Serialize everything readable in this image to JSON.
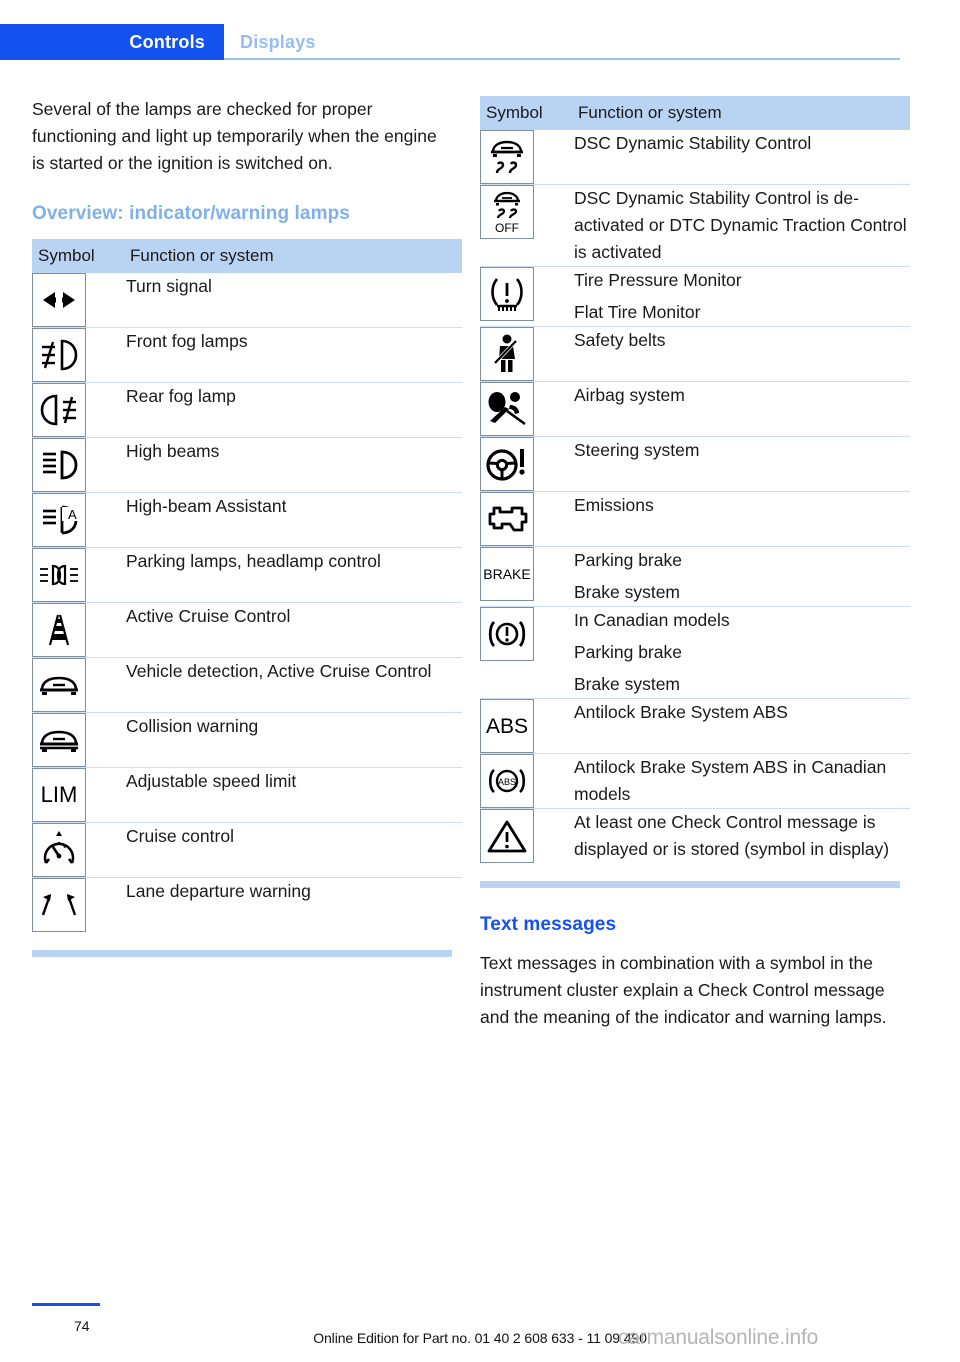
{
  "header": {
    "active_tab": "Controls",
    "inactive_tab": "Displays"
  },
  "left_column": {
    "intro_paragraph": "Several of the lamps are checked for proper functioning and light up temporarily when the engine is started or the ignition is switched on.",
    "section_title": "Overview: indicator/warning lamps",
    "table": {
      "headers": [
        "Symbol",
        "Function or system"
      ],
      "rows": [
        {
          "icon": "turn-signal-icon",
          "lines": [
            "Turn signal"
          ]
        },
        {
          "icon": "front-fog-lamps-icon",
          "lines": [
            "Front fog lamps"
          ]
        },
        {
          "icon": "rear-fog-lamp-icon",
          "lines": [
            "Rear fog lamp"
          ]
        },
        {
          "icon": "high-beams-icon",
          "lines": [
            "High beams"
          ]
        },
        {
          "icon": "high-beam-assistant-icon",
          "lines": [
            "High-beam Assistant"
          ]
        },
        {
          "icon": "parking-lamps-headlamp-control-icon",
          "lines": [
            "Parking lamps, headlamp control"
          ]
        },
        {
          "icon": "active-cruise-control-icon",
          "lines": [
            "Active Cruise Control"
          ]
        },
        {
          "icon": "vehicle-detection-icon",
          "lines": [
            "Vehicle detection, Active Cruise Control"
          ]
        },
        {
          "icon": "collision-warning-icon",
          "lines": [
            "Collision warning"
          ]
        },
        {
          "icon": "adjustable-speed-limit-icon",
          "lines": [
            "Adjustable speed limit"
          ]
        },
        {
          "icon": "cruise-control-icon",
          "lines": [
            "Cruise control"
          ]
        },
        {
          "icon": "lane-departure-warning-icon",
          "lines": [
            "Lane departure warning"
          ]
        }
      ]
    }
  },
  "right_column": {
    "table": {
      "headers": [
        "Symbol",
        "Function or system"
      ],
      "rows": [
        {
          "icon": "dsc-icon",
          "lines": [
            "DSC Dynamic Stability Control"
          ]
        },
        {
          "icon": "dsc-off-icon",
          "lines": [
            "DSC Dynamic Stability Control is de-activated or DTC Dynamic Traction Control is activated"
          ]
        },
        {
          "icon": "tire-pressure-monitor-icon",
          "lines": [
            "Tire Pressure Monitor",
            "Flat Tire Monitor"
          ]
        },
        {
          "icon": "safety-belts-icon",
          "lines": [
            "Safety belts"
          ]
        },
        {
          "icon": "airbag-system-icon",
          "lines": [
            "Airbag system"
          ]
        },
        {
          "icon": "steering-system-icon",
          "lines": [
            "Steering system"
          ]
        },
        {
          "icon": "emissions-icon",
          "lines": [
            "Emissions"
          ]
        },
        {
          "icon": "brake-text-icon",
          "lines": [
            "Parking brake",
            "Brake system"
          ]
        },
        {
          "icon": "canadian-brake-icon",
          "lines": [
            "In Canadian models",
            "Parking brake",
            "Brake system"
          ]
        },
        {
          "icon": "abs-text-icon",
          "lines": [
            "Antilock Brake System ABS"
          ]
        },
        {
          "icon": "abs-canadian-icon",
          "lines": [
            "Antilock Brake System ABS in Canadian models"
          ]
        },
        {
          "icon": "check-control-warning-icon",
          "lines": [
            "At least one Check Control message is displayed or is stored (symbol in display)"
          ]
        }
      ]
    },
    "section_title": "Text messages",
    "paragraph": "Text messages in combination with a symbol in the instrument cluster explain a Check Control message and the meaning of the indicator and warning lamps."
  },
  "icon_glyph_text": {
    "dsc_off": "OFF",
    "brake": "BRAKE",
    "abs": "ABS",
    "abs_small": "ABS",
    "lim": "LIM",
    "high_beam_assistant": "A"
  },
  "footer": {
    "page_number": "74",
    "edition_line": "Online Edition for Part no. 01 40 2 608 633 - 11 09 490",
    "watermark": "carmanualsonline.info"
  },
  "colors": {
    "tab_active_bg": "#1452f0",
    "tab_inactive_text": "#97bdf7",
    "table_header_bg": "#b9d4f2",
    "row_divider": "#cadff5",
    "heading_light_blue": "#7fb0ec",
    "heading_blue": "#1452f0"
  }
}
